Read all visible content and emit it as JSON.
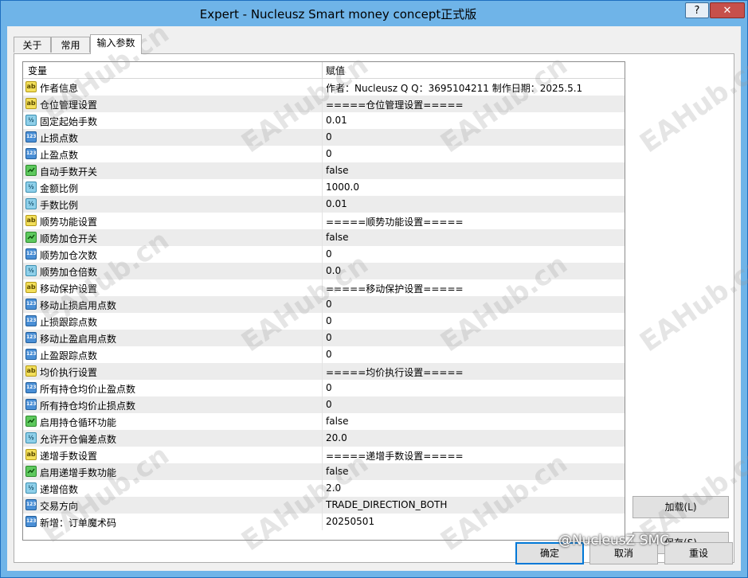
{
  "window": {
    "title": "Expert - Nucleusz Smart money concept正式版",
    "help_label": "?",
    "close_label": "✕"
  },
  "tabs": [
    {
      "label": "关于"
    },
    {
      "label": "常用"
    },
    {
      "label": "输入参数",
      "active": true
    }
  ],
  "grid": {
    "col_variable": "变量",
    "col_value": "赋值",
    "rows": [
      {
        "type": "ab",
        "name": "作者信息",
        "value": "作者：Nucleusz  Q Q：3695104211 制作日期：2025.5.1"
      },
      {
        "type": "ab",
        "name": "仓位管理设置",
        "value": "=====仓位管理设置====="
      },
      {
        "type": "frac",
        "name": "固定起始手数",
        "value": "0.01"
      },
      {
        "type": "n123",
        "name": "止损点数",
        "value": "0"
      },
      {
        "type": "n123",
        "name": "止盈点数",
        "value": "0"
      },
      {
        "type": "bool",
        "name": "自动手数开关",
        "value": "false"
      },
      {
        "type": "frac",
        "name": "金额比例",
        "value": "1000.0"
      },
      {
        "type": "frac",
        "name": "手数比例",
        "value": "0.01"
      },
      {
        "type": "ab",
        "name": "顺势功能设置",
        "value": "=====顺势功能设置====="
      },
      {
        "type": "bool",
        "name": "顺势加仓开关",
        "value": "false"
      },
      {
        "type": "n123",
        "name": "顺势加仓次数",
        "value": "0"
      },
      {
        "type": "frac",
        "name": "顺势加仓倍数",
        "value": "0.0"
      },
      {
        "type": "ab",
        "name": "移动保护设置",
        "value": "=====移动保护设置====="
      },
      {
        "type": "n123",
        "name": "移动止损启用点数",
        "value": "0"
      },
      {
        "type": "n123",
        "name": "止损跟踪点数",
        "value": "0"
      },
      {
        "type": "n123",
        "name": "移动止盈启用点数",
        "value": "0"
      },
      {
        "type": "n123",
        "name": "止盈跟踪点数",
        "value": "0"
      },
      {
        "type": "ab",
        "name": "均价执行设置",
        "value": "=====均价执行设置====="
      },
      {
        "type": "n123",
        "name": "所有持仓均价止盈点数",
        "value": "0"
      },
      {
        "type": "n123",
        "name": "所有持仓均价止损点数",
        "value": "0"
      },
      {
        "type": "bool",
        "name": "启用持仓循环功能",
        "value": "false"
      },
      {
        "type": "frac",
        "name": "允许开仓偏差点数",
        "value": "20.0"
      },
      {
        "type": "ab",
        "name": "递增手数设置",
        "value": "=====递增手数设置====="
      },
      {
        "type": "bool",
        "name": "启用递增手数功能",
        "value": "false"
      },
      {
        "type": "frac",
        "name": "递增倍数",
        "value": "2.0"
      },
      {
        "type": "n123",
        "name": "交易方向",
        "value": "TRADE_DIRECTION_BOTH"
      },
      {
        "type": "n123",
        "name": "新增：订单魔术码",
        "value": "20250501"
      }
    ]
  },
  "icons": {
    "ab": "ab",
    "n123": "123",
    "frac": "½"
  },
  "buttons": {
    "load": "加载(L)",
    "save": "保存(S)",
    "ok": "确定",
    "cancel": "取消",
    "reset": "重设"
  },
  "watermark": "EAHub.cn",
  "credit": "@NucleusZ SMC"
}
